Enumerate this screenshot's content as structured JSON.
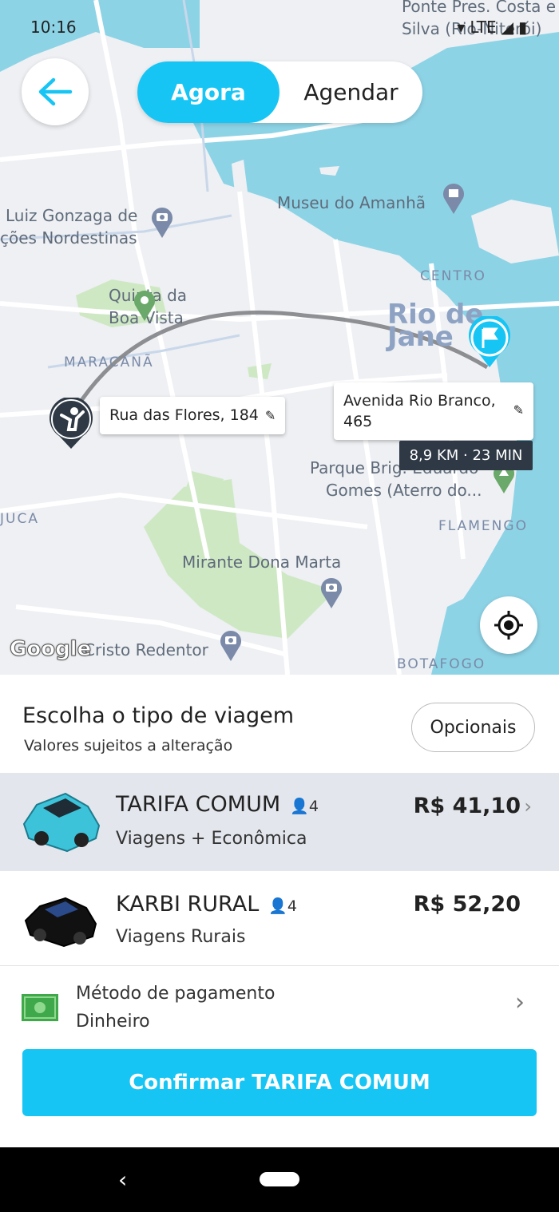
{
  "status": {
    "time": "10:16",
    "network": "LTE"
  },
  "header": {
    "toggle": {
      "active": "Agora",
      "inactive": "Agendar"
    }
  },
  "map": {
    "labels": {
      "ponte": "Ponte Pres. Costa e Silva (Rio-Niterói)",
      "museu": "Museu do Amanhã",
      "luiz": "Luiz Gonzaga de",
      "nordestinas": "ções Nordestinas",
      "quinta": "Quinta da",
      "boavista": "Boa Vista",
      "centro": "CENTRO",
      "rio": "Rio de Jane",
      "maracana": "MARACANÃ",
      "parque1": "Parque Brig. Eduardo",
      "parque2": "Gomes (Aterro do...",
      "juca": "JUCA",
      "flamengo": "FLAMENGO",
      "mirante": "Mirante Dona Marta",
      "cristo": "Cristo Redentor",
      "botafogo": "BOTAFOGO",
      "google": "Google"
    },
    "origin": "Rua das Flores, 184",
    "destination": "Avenida Rio Branco, 465",
    "eta": "8,9 KM · 23 MIN"
  },
  "panel": {
    "title": "Escolha o tipo de viagem",
    "subtitle": "Valores sujeitos a alteração",
    "options_button": "Opcionais",
    "rides": [
      {
        "name": "TARIFA COMUM",
        "seats": "4",
        "desc": "Viagens + Econômica",
        "price": "R$ 41,10",
        "color": "#3cc3d9"
      },
      {
        "name": "KARBI RURAL",
        "seats": "4",
        "desc": "Viagens Rurais",
        "price": "R$ 52,20",
        "color": "#111111"
      }
    ],
    "payment": {
      "label": "Método de pagamento",
      "value": "Dinheiro"
    },
    "confirm": "Confirmar TARIFA COMUM"
  },
  "colors": {
    "accent": "#17c5f4",
    "water": "#8dd3e6",
    "park": "#cfe8c4"
  }
}
